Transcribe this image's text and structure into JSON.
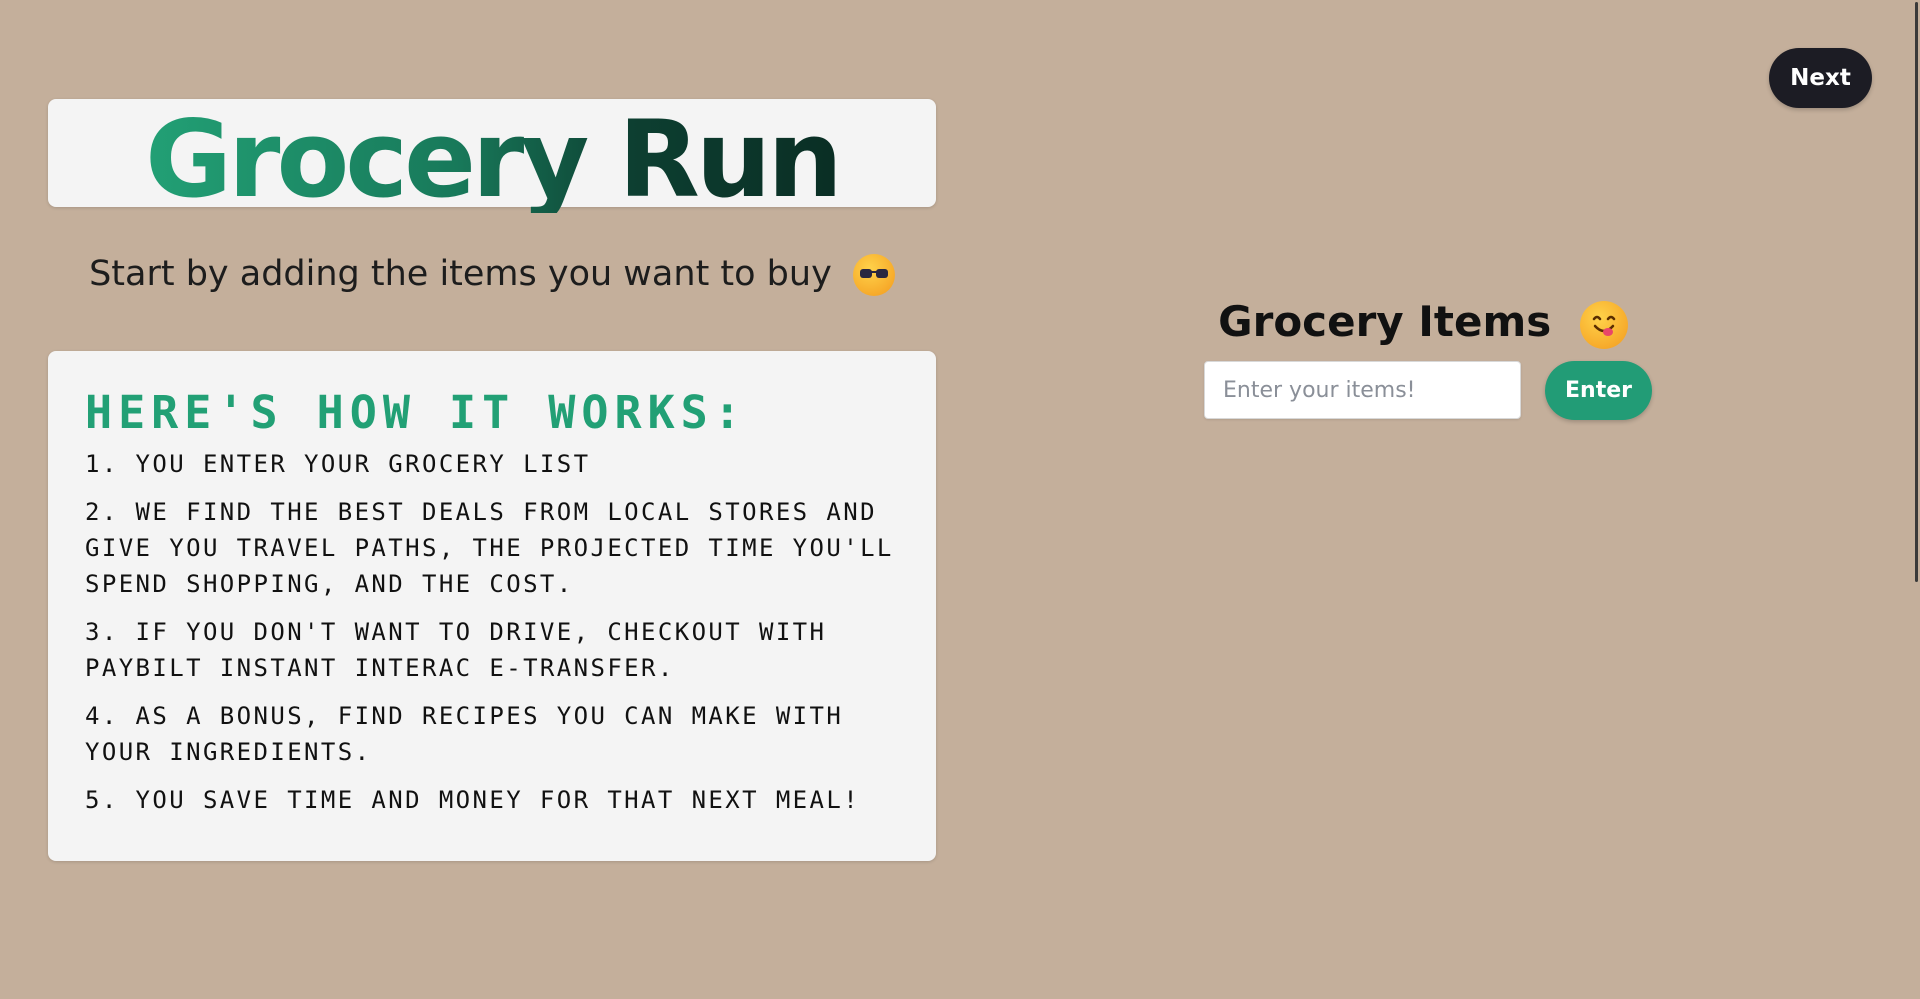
{
  "header": {
    "title": "Grocery Run",
    "subtitle": "Start by adding the items you want to buy",
    "subtitle_emoji": "sunglasses-face-emoji",
    "title_gradient": [
      "#22a075",
      "#0a2e24"
    ]
  },
  "how_it_works": {
    "heading": "Here's how it works:",
    "steps": [
      "1. You enter your grocery list",
      "2. We find the best deals from local stores and give you travel paths, the projected time you'll spend shopping, and the cost.",
      "3. If you don't want to drive, checkout with PayBilt Instant Interac e-Transfer.",
      "4. As a bonus, find recipes you can make with your ingredients.",
      "5. You save time and money for that next meal!"
    ]
  },
  "nav": {
    "next_label": "Next"
  },
  "grocery_items": {
    "heading": "Grocery Items",
    "heading_emoji": "yum-face-emoji",
    "input_placeholder": "Enter your items!",
    "input_value": "",
    "enter_label": "Enter"
  },
  "colors": {
    "background": "#c4af9b",
    "card": "#f4f4f4",
    "accent_green": "#229c76",
    "dark_button": "#1c1c24"
  }
}
